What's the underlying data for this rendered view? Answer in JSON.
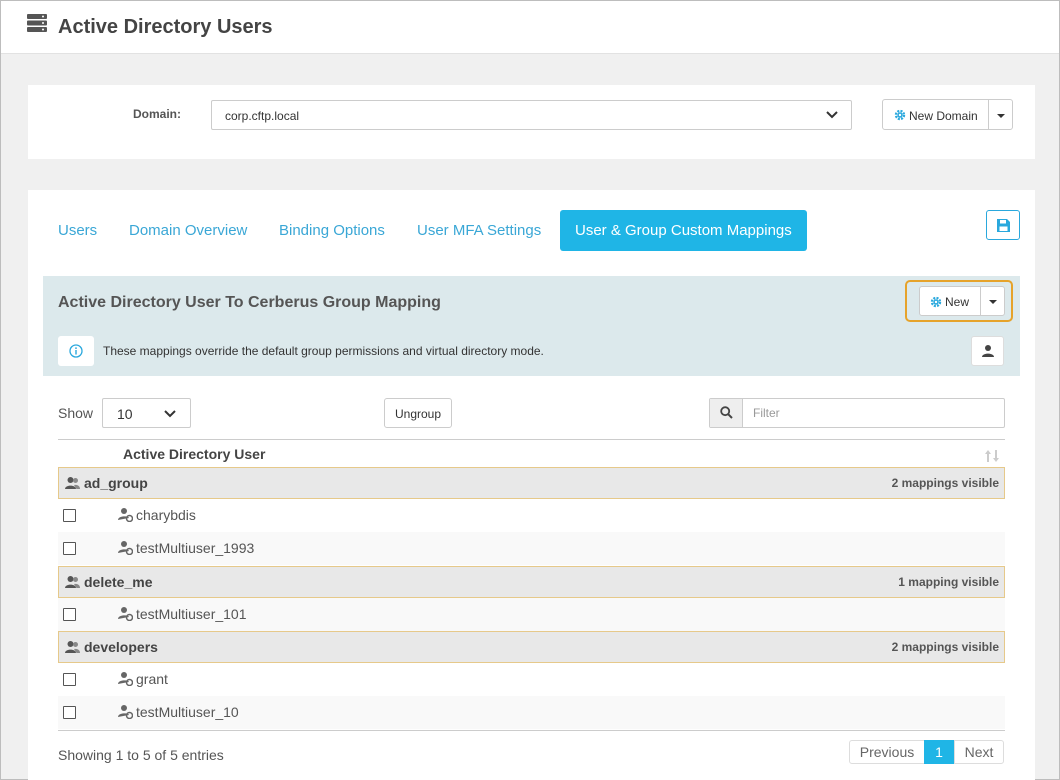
{
  "header": {
    "title": "Active Directory Users",
    "icon": "server-icon"
  },
  "domain": {
    "label": "Domain:",
    "selected": "corp.cftp.local",
    "new_domain_label": "New Domain"
  },
  "tabs": [
    {
      "label": "Users",
      "active": false
    },
    {
      "label": "Domain Overview",
      "active": false
    },
    {
      "label": "Binding Options",
      "active": false
    },
    {
      "label": "User MFA Settings",
      "active": false
    },
    {
      "label": "User & Group Custom Mappings",
      "active": true
    }
  ],
  "panel": {
    "title": "Active Directory User To Cerberus Group Mapping",
    "new_label": "New",
    "info_text": "These mappings override the default group permissions and virtual directory mode."
  },
  "controls": {
    "show_label": "Show",
    "page_size": "10",
    "ungroup_label": "Ungroup",
    "filter_placeholder": "Filter"
  },
  "table": {
    "column": "Active Directory User",
    "groups": [
      {
        "name": "ad_group",
        "count_text": "2 mappings visible",
        "users": [
          "charybdis",
          "testMultiuser_1993"
        ]
      },
      {
        "name": "delete_me",
        "count_text": "1 mapping visible",
        "users": [
          "testMultiuser_101"
        ]
      },
      {
        "name": "developers",
        "count_text": "2 mappings visible",
        "users": [
          "grant",
          "testMultiuser_10"
        ]
      }
    ]
  },
  "footer": {
    "showing_text": "Showing 1 to 5 of 5 entries",
    "previous_label": "Previous",
    "current_page": "1",
    "next_label": "Next"
  },
  "colors": {
    "accent": "#1fb5e6",
    "highlight": "#e6a32b",
    "panel_bg": "#dce9ec"
  }
}
